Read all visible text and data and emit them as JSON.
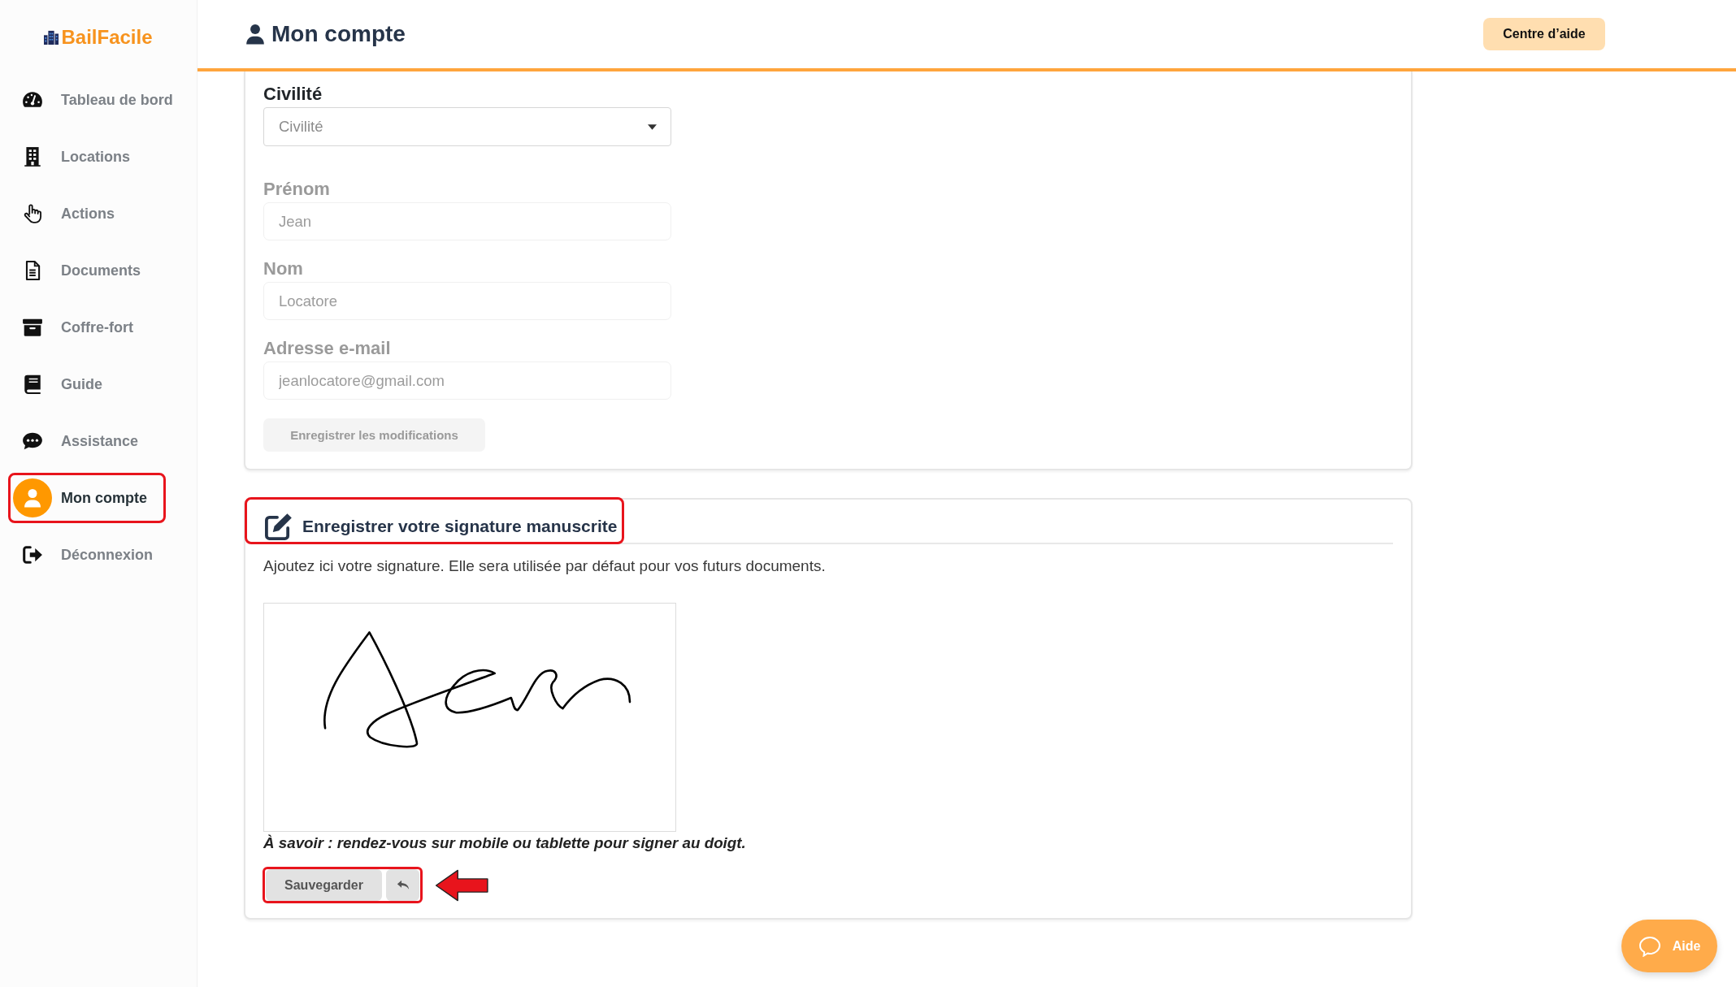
{
  "sidebar": {
    "logo": "BailFacile",
    "items": [
      {
        "label": "Tableau de bord",
        "selected": false,
        "highlighted": false
      },
      {
        "label": "Locations",
        "selected": false,
        "highlighted": false
      },
      {
        "label": "Actions",
        "selected": false,
        "highlighted": false
      },
      {
        "label": "Documents",
        "selected": false,
        "highlighted": false
      },
      {
        "label": "Coffre-fort",
        "selected": false,
        "highlighted": false
      },
      {
        "label": "Guide",
        "selected": false,
        "highlighted": false
      },
      {
        "label": "Assistance",
        "selected": false,
        "highlighted": false
      },
      {
        "label": "Mon compte",
        "selected": true,
        "highlighted": true
      },
      {
        "label": "Déconnexion",
        "selected": false,
        "highlighted": false
      }
    ]
  },
  "header": {
    "title": "Mon compte",
    "help_button": "Centre d’aide"
  },
  "profile_form": {
    "fields": [
      {
        "kind": "select",
        "label": "Civilité",
        "placeholder": "Civilité",
        "disabled": false
      },
      {
        "kind": "text",
        "label": "Prénom",
        "value": "Jean",
        "disabled": true
      },
      {
        "kind": "text",
        "label": "Nom",
        "value": "Locatore",
        "disabled": true
      },
      {
        "kind": "text",
        "label": "Adresse e-mail",
        "value": "jeanlocatore@gmail.com",
        "disabled": true
      }
    ],
    "submit": {
      "label": "Enregistrer les modifications",
      "disabled": true
    }
  },
  "signature": {
    "title": "Enregistrer votre signature manuscrite",
    "title_highlighted": true,
    "description": "Ajoutez ici votre signature. Elle sera utilisée par défaut pour vos futurs documents.",
    "pad": {
      "signed": true
    },
    "note": "À savoir : rendez-vous sur mobile ou tablette pour signer au doigt.",
    "save_button": "Sauvegarder",
    "buttons_highlighted": true,
    "arrow": true
  },
  "help_widget": {
    "label": "Aide"
  }
}
